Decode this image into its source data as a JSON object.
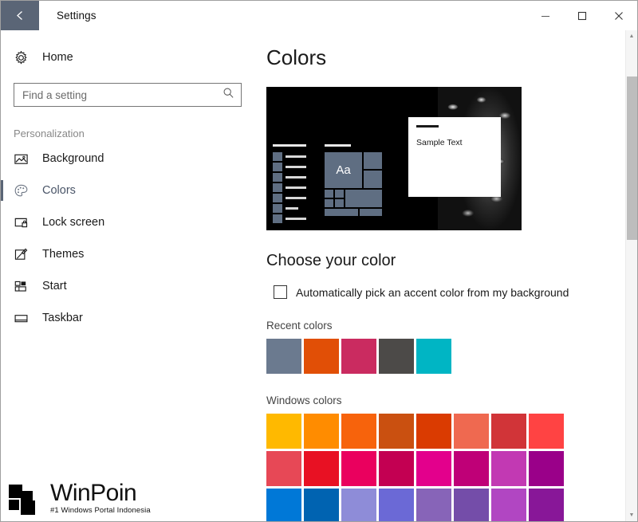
{
  "window": {
    "title": "Settings",
    "back_icon": "back-arrow-icon",
    "minimize_label": "–",
    "maximize_label": "□",
    "close_label": "✕"
  },
  "sidebar": {
    "home": {
      "label": "Home",
      "icon": "gear-icon"
    },
    "search": {
      "placeholder": "Find a setting",
      "value": "",
      "icon": "search-icon"
    },
    "section_label": "Personalization",
    "items": [
      {
        "label": "Background",
        "icon": "picture-icon",
        "selected": false
      },
      {
        "label": "Colors",
        "icon": "palette-icon",
        "selected": true
      },
      {
        "label": "Lock screen",
        "icon": "lock-screen-icon",
        "selected": false
      },
      {
        "label": "Themes",
        "icon": "brush-icon",
        "selected": false
      },
      {
        "label": "Start",
        "icon": "start-tiles-icon",
        "selected": false
      },
      {
        "label": "Taskbar",
        "icon": "taskbar-icon",
        "selected": false
      }
    ]
  },
  "main": {
    "page_title": "Colors",
    "preview": {
      "sample_window_text": "Sample Text",
      "tile_text": "Aa",
      "accent_color": "#5f6e82",
      "background_color": "#000000"
    },
    "choose_heading": "Choose your color",
    "auto_accent": {
      "label": "Automatically pick an accent color from my background",
      "checked": false
    },
    "recent_colors_label": "Recent colors",
    "recent_colors": [
      "#6b7a8f",
      "#e14f06",
      "#ca2b60",
      "#4c4a48",
      "#00b5c4"
    ],
    "windows_colors_label": "Windows colors",
    "windows_colors": [
      "#ffb900",
      "#ff8c00",
      "#f7630c",
      "#ca5010",
      "#da3b01",
      "#ef6950",
      "#d13438",
      "#ff4343",
      "#e74856",
      "#e81123",
      "#ea005e",
      "#c30052",
      "#e3008c",
      "#bf0077",
      "#c239b3",
      "#9a0089",
      "#0078d7",
      "#0063b1",
      "#8e8cd8",
      "#6b69d6",
      "#8764b8",
      "#744da9",
      "#b146c2",
      "#881798"
    ]
  },
  "scrollbar": {
    "up_label": "▲",
    "down_label": "▼"
  },
  "watermark": {
    "name": "WinPoin",
    "tagline": "#1 Windows Portal Indonesia"
  }
}
